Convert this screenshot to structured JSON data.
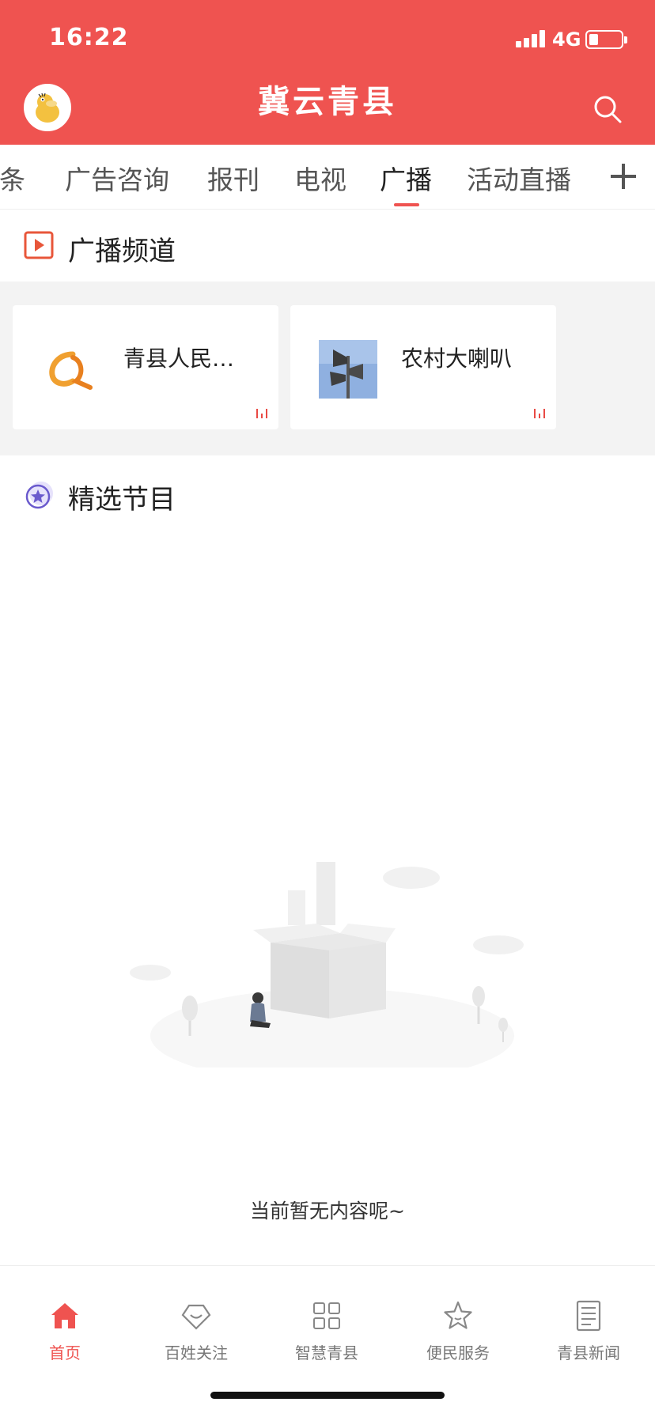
{
  "status_bar": {
    "time": "16:22",
    "network": "4G"
  },
  "app": {
    "title": "冀云青县"
  },
  "tabs": [
    {
      "label": "头条"
    },
    {
      "label": "广告咨询"
    },
    {
      "label": "报刊"
    },
    {
      "label": "电视"
    },
    {
      "label": "广播",
      "active": true
    },
    {
      "label": "活动直播"
    }
  ],
  "sections": {
    "channels": {
      "title": "广播频道"
    },
    "featured": {
      "title": "精选节目"
    }
  },
  "channels": [
    {
      "name": "青县人民…"
    },
    {
      "name": "农村大喇叭"
    }
  ],
  "empty_state": {
    "message": "当前暂无内容呢~"
  },
  "bottom_nav": [
    {
      "label": "首页",
      "icon": "home-icon",
      "active": true
    },
    {
      "label": "百姓关注",
      "icon": "heart-diamond-icon"
    },
    {
      "label": "智慧青县",
      "icon": "grid-icon"
    },
    {
      "label": "便民服务",
      "icon": "star-icon"
    },
    {
      "label": "青县新闻",
      "icon": "news-icon"
    }
  ],
  "colors": {
    "brand": "#ef5350",
    "accent_purple": "#6a5acd",
    "icon_orange": "#e8563a"
  }
}
